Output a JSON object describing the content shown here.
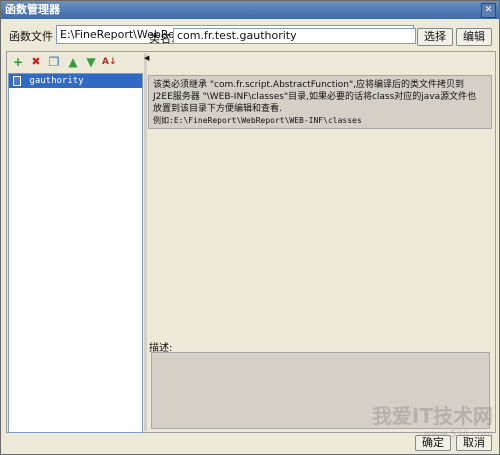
{
  "window": {
    "title": "函数管理器"
  },
  "path": {
    "label": "函数文件",
    "value": "E:\\FineReport\\WebReport\\WEB-INF\\resources\\functions.xml"
  },
  "toolbar": {
    "add": "+",
    "delete": "✖",
    "copy": "❐",
    "move_up": "▲",
    "move_down": "▼",
    "sort": "A↓"
  },
  "function_list": {
    "items": [
      "gauthority"
    ]
  },
  "detail": {
    "class_label": "类名:",
    "class_value": "com.fr.test.gauthority",
    "select_button": "选择",
    "edit_button": "编辑",
    "info_line1": "该类必须继承 \"com.fr.script.AbstractFunction\",应将编译后的类文件拷贝到",
    "info_line2": "J2EE服务器 \"\\WEB-INF\\classes\"目录,如果必要的话将class对应的java源文件也",
    "info_line3": "放置到该目录下方便编辑和查看.",
    "info_line4": "例如:E:\\FineReport\\WebReport\\WEB-INF\\classes",
    "description_label": "描述:"
  },
  "footer": {
    "ok": "确定",
    "cancel": "取消"
  },
  "watermark": {
    "text": "我爱IT技术网",
    "url": "www.52ij.com"
  }
}
